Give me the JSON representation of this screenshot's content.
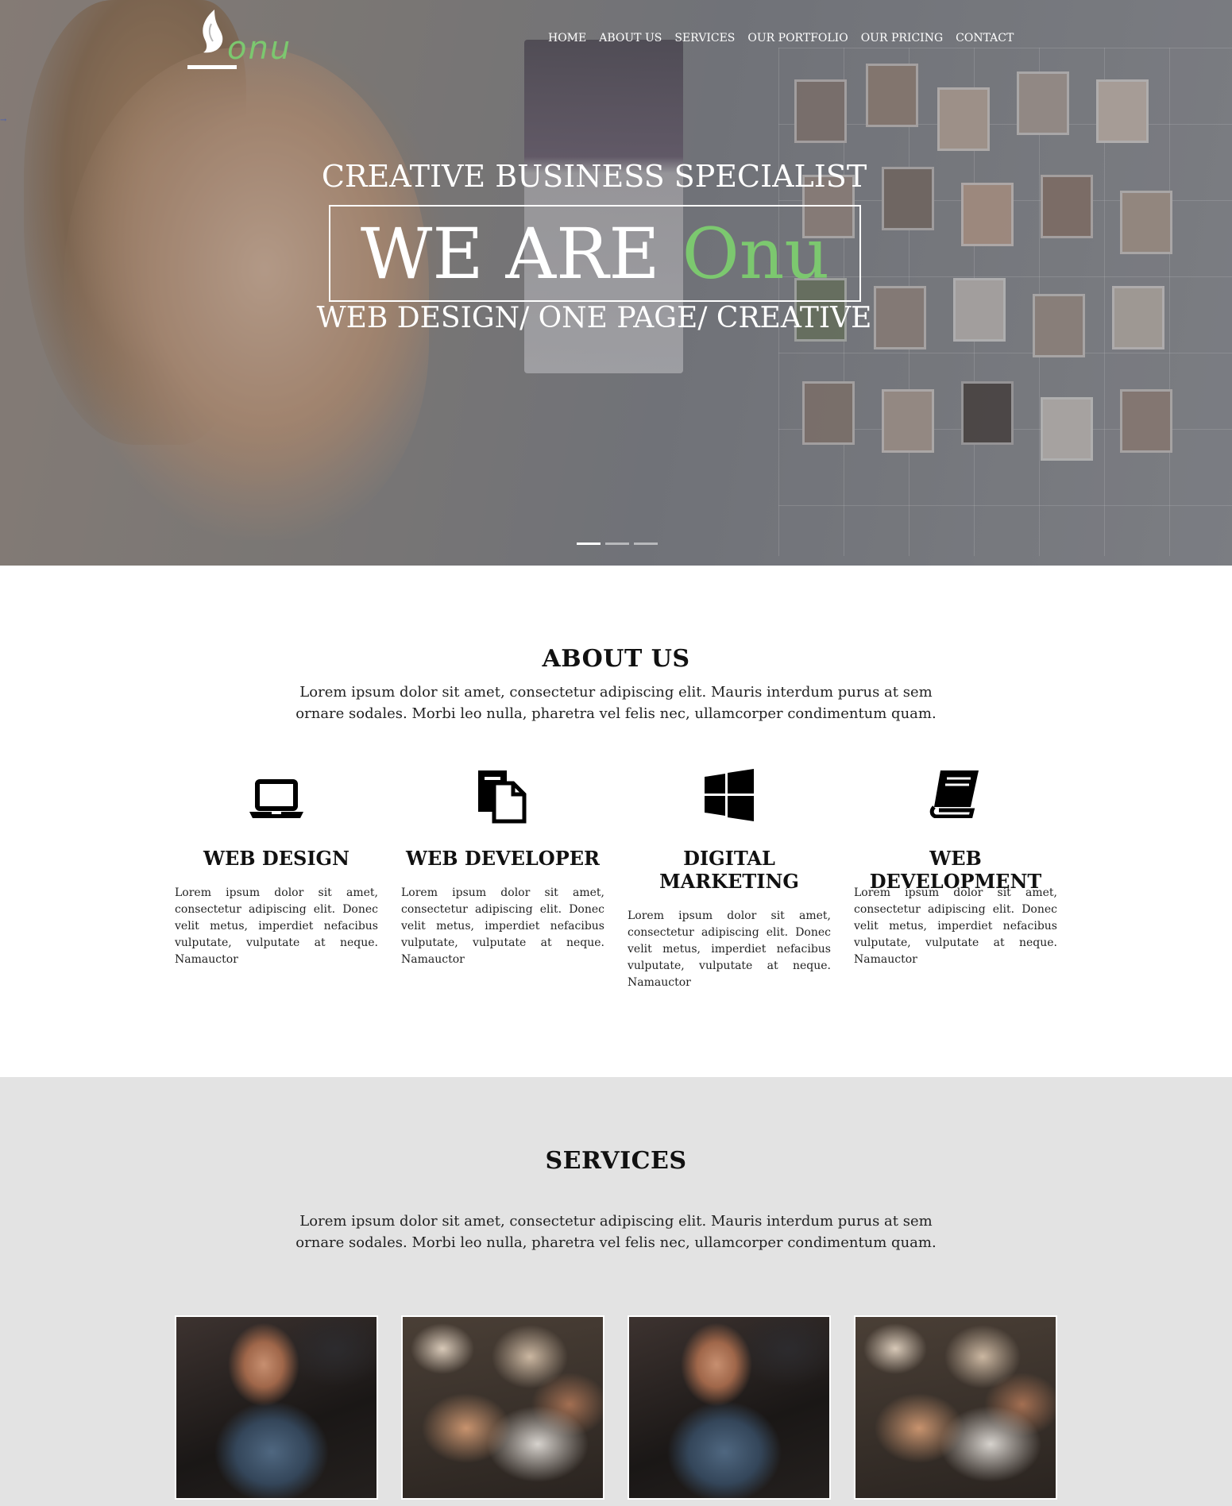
{
  "brand": {
    "logo_text": "onu",
    "accent_color": "#7cc86f"
  },
  "nav": {
    "items": [
      "HOME",
      "ABOUT US",
      "SERVICES",
      "OUR PORTFOLIO",
      "OUR PRICING",
      "CONTACT"
    ]
  },
  "hero": {
    "title": "CREATIVE BUSINESS SPECIALIST",
    "big_prefix": "WE ARE",
    "big_accent": "Onu",
    "subtitle": "WEB DESIGN/ ONE PAGE/ CREATIVE",
    "slides": 3,
    "active_slide": 1
  },
  "about": {
    "title": "ABOUT US",
    "text_line1": "Lorem ipsum dolor sit amet, consectetur adipiscing elit. Mauris interdum purus at sem",
    "text_line2": "ornare sodales. Morbi leo nulla, pharetra vel felis nec, ullamcorper condimentum quam.",
    "features": [
      {
        "icon": "laptop-icon",
        "title": "WEB DESIGN",
        "text": "Lorem ipsum dolor sit amet, consectetur adipiscing elit. Donec velit metus, imperdiet nefacibus vulputate, vulputate at neque. Namauctor"
      },
      {
        "icon": "document-icon",
        "title": "WEB DEVELOPER",
        "text": "Lorem ipsum dolor sit amet, consectetur adipiscing elit. Donec velit metus, imperdiet nefacibus vulputate, vulputate at neque. Namauctor"
      },
      {
        "icon": "windows-icon",
        "title": "DIGITAL MARKETING",
        "text": "Lorem ipsum dolor sit amet, consectetur adipiscing elit. Donec velit metus, imperdiet nefacibus vulputate, vulputate at neque. Namauctor"
      },
      {
        "icon": "book-icon",
        "title": "WEB DEVELOPMENT",
        "text": "Lorem ipsum dolor sit amet, consectetur adipiscing elit. Donec velit metus, imperdiet nefacibus vulputate, vulputate at neque. Namauctor"
      }
    ]
  },
  "services": {
    "title": "SERVICES",
    "text_line1": "Lorem ipsum dolor sit amet, consectetur adipiscing elit. Mauris interdum purus at sem",
    "text_line2": "ornare sodales. Morbi leo nulla, pharetra vel felis nec, ullamcorper condimentum quam."
  }
}
